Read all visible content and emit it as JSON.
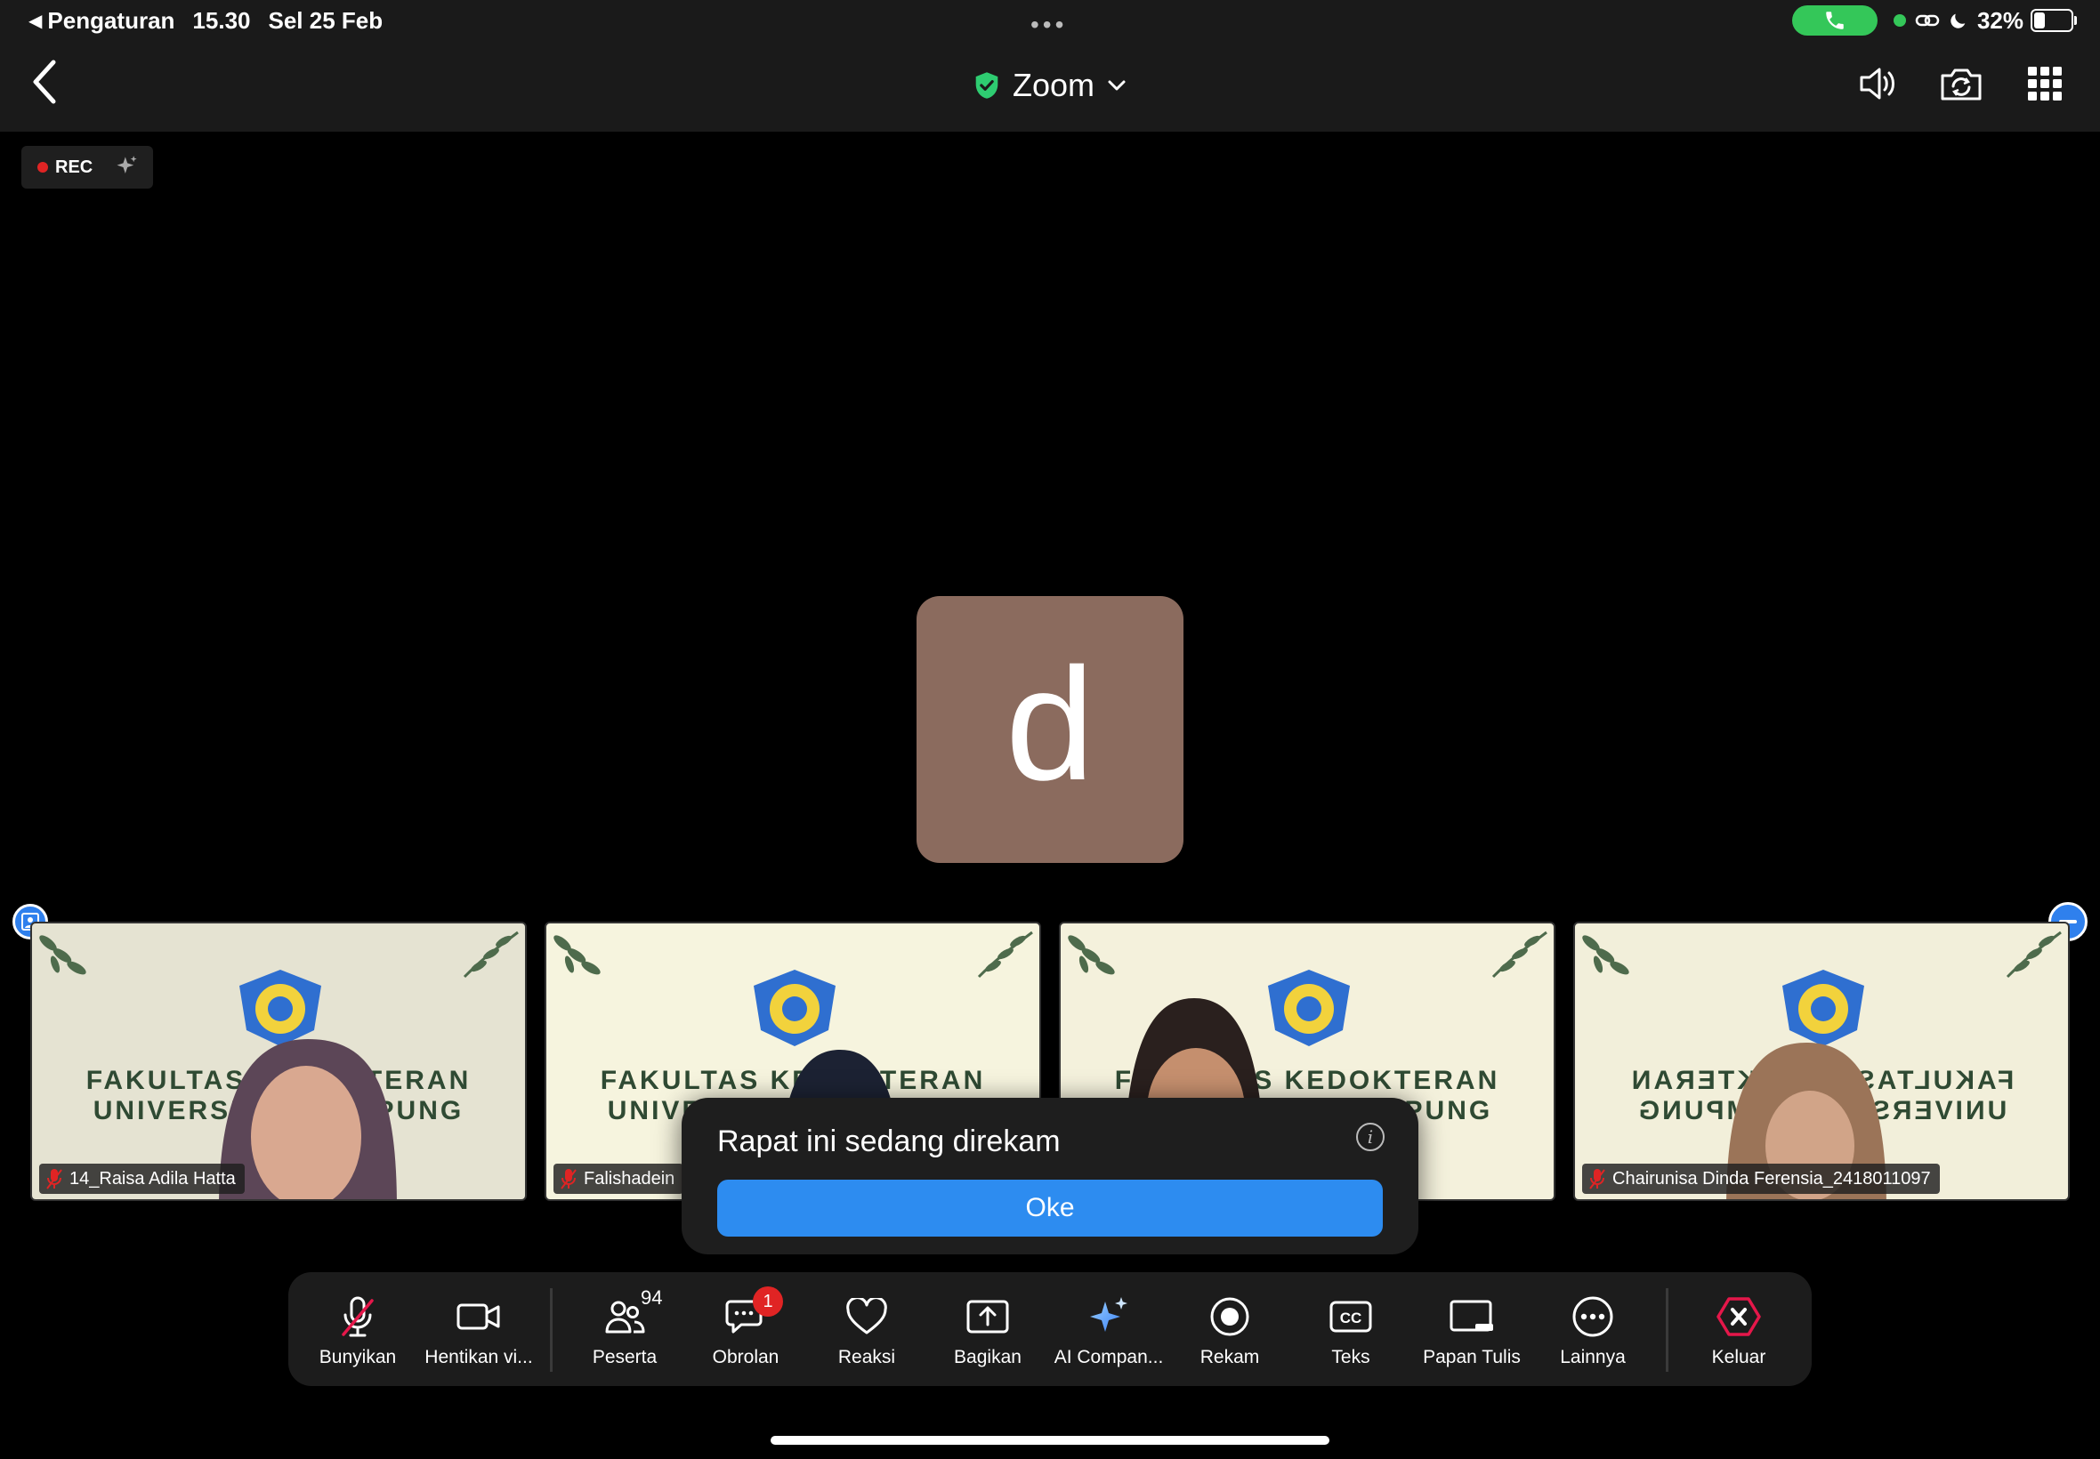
{
  "status_bar": {
    "back_app": "Pengaturan",
    "time": "15.30",
    "date": "Sel 25 Feb",
    "battery": "32%",
    "battery_level": 0.32,
    "call_color": "#34c759"
  },
  "header": {
    "title": "Zoom",
    "secure_icon": "shield-check-icon",
    "icons": [
      "speaker-icon",
      "camera-switch-icon",
      "grid-icon"
    ]
  },
  "recording": {
    "label": "REC",
    "sparkle_icon": "sparkle-icon"
  },
  "active_speaker": {
    "avatar_letter": "d",
    "avatar_color": "#8b6b5e"
  },
  "gallery": {
    "banner_line1": "FAKULTAS KEDOKTERAN",
    "banner_line2": "UNIVERSITAS LAMPUNG",
    "participants": [
      {
        "name": "14_Raisa Adila Hatta",
        "muted": true
      },
      {
        "name": "Falishadein",
        "muted": true
      },
      {
        "name": "",
        "muted": false
      },
      {
        "name": "Chairunisa Dinda Ferensia_2418011097",
        "muted": true
      }
    ]
  },
  "toast": {
    "message": "Rapat ini sedang direkam",
    "button": "Oke",
    "button_color": "#2d8cf0"
  },
  "toolbar": {
    "items": [
      {
        "label": "Bunyikan",
        "icon": "mic-muted-icon"
      },
      {
        "label": "Hentikan vi...",
        "icon": "video-camera-icon"
      },
      {
        "label": "Peserta",
        "icon": "participants-icon",
        "count": "94"
      },
      {
        "label": "Obrolan",
        "icon": "chat-icon",
        "badge": "1"
      },
      {
        "label": "Reaksi",
        "icon": "heart-icon"
      },
      {
        "label": "Bagikan",
        "icon": "share-icon"
      },
      {
        "label": "AI Compan...",
        "icon": "ai-sparkle-icon"
      },
      {
        "label": "Rekam",
        "icon": "record-icon"
      },
      {
        "label": "Teks",
        "icon": "cc-icon"
      },
      {
        "label": "Papan Tulis",
        "icon": "whiteboard-icon"
      },
      {
        "label": "Lainnya",
        "icon": "more-icon"
      },
      {
        "label": "Keluar",
        "icon": "leave-icon"
      }
    ],
    "leave_color": "#e5174a"
  }
}
